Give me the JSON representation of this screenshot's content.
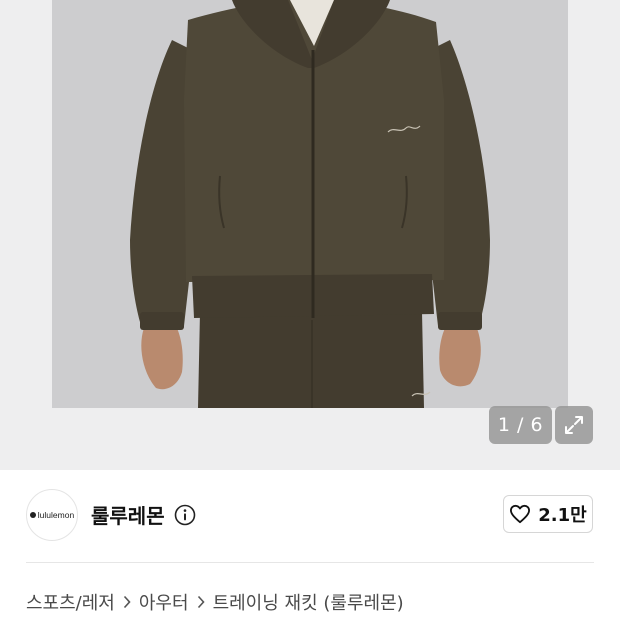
{
  "gallery": {
    "image_alt": "lululemon dark olive zip-up training jacket",
    "counter": "1 / 6",
    "icons": {
      "expand": "expand-arrows-icon"
    }
  },
  "seller": {
    "logo_text": "lululemon",
    "name": "룰루레몬",
    "info_icon": "info-icon"
  },
  "like": {
    "icon": "heart-outline-icon",
    "count": "2.1만"
  },
  "breadcrumb": {
    "items": [
      "스포츠/레저",
      "아우터",
      "트레이닝 재킷 (룰루레몬)"
    ],
    "separator_icon": "chevron-right-icon"
  },
  "colors": {
    "jacket": "#4a4334",
    "photo_bg": "#cdcdcf",
    "gallery_bg": "#eeeeef"
  }
}
